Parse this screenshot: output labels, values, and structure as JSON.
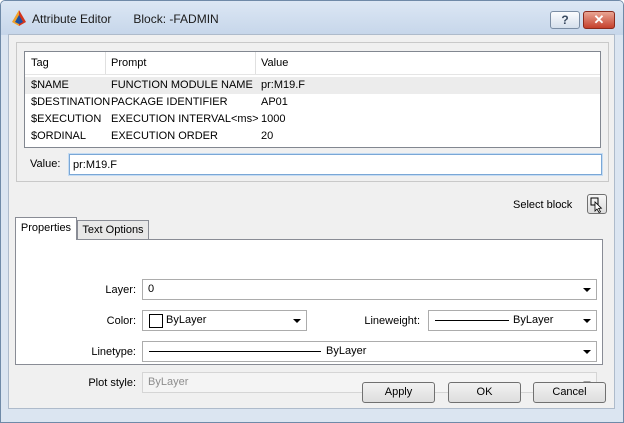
{
  "window": {
    "title": "Attribute Editor",
    "block_label": "Block: -FADMIN",
    "help_label": "?",
    "close_label": "✕"
  },
  "attributes": {
    "columns": [
      "Tag",
      "Prompt",
      "Value"
    ],
    "rows": [
      {
        "tag": "$NAME",
        "prompt": "FUNCTION MODULE NAME",
        "value": "pr:M19.F",
        "selected": true
      },
      {
        "tag": "$DESTINATION",
        "prompt": "PACKAGE IDENTIFIER",
        "value": "AP01"
      },
      {
        "tag": "$EXECUTION",
        "prompt": "EXECUTION INTERVAL<ms>",
        "value": "1000"
      },
      {
        "tag": "$ORDINAL",
        "prompt": "EXECUTION ORDER",
        "value": "20"
      }
    ]
  },
  "value_field": {
    "label": "Value:",
    "value": "pr:M19.F"
  },
  "select_block": {
    "label": "Select block"
  },
  "tabs": [
    {
      "label": "Properties",
      "active": true
    },
    {
      "label": "Text Options",
      "active": false
    }
  ],
  "properties": {
    "layer": {
      "label": "Layer:",
      "value": "0"
    },
    "color": {
      "label": "Color:",
      "value": "ByLayer"
    },
    "lineweight": {
      "label": "Lineweight:",
      "value": "ByLayer"
    },
    "linetype": {
      "label": "Linetype:",
      "value": "ByLayer"
    },
    "plot_style": {
      "label": "Plot style:",
      "value": "ByLayer",
      "disabled": true
    }
  },
  "buttons": {
    "apply": "Apply",
    "ok": "OK",
    "cancel": "Cancel"
  }
}
